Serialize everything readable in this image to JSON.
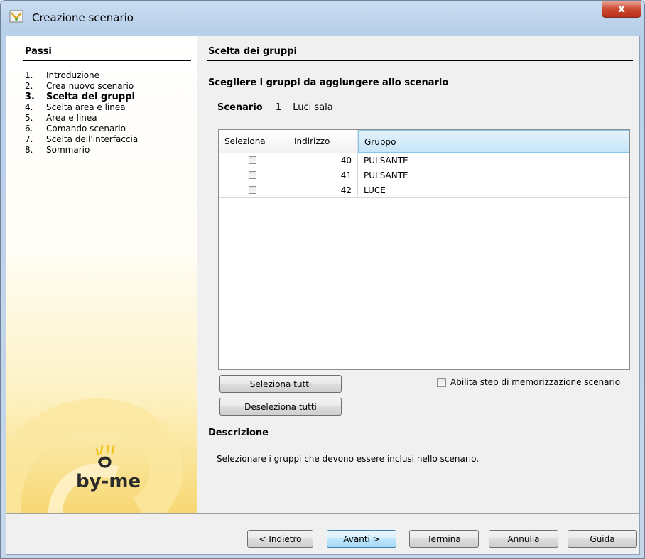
{
  "window": {
    "title": "Creazione scenario",
    "close_label": "x"
  },
  "sidebar": {
    "title": "Passi",
    "steps": [
      {
        "num": "1.",
        "label": "Introduzione"
      },
      {
        "num": "2.",
        "label": "Crea nuovo scenario"
      },
      {
        "num": "3.",
        "label": "Scelta dei gruppi"
      },
      {
        "num": "4.",
        "label": "Scelta area e linea"
      },
      {
        "num": "5.",
        "label": "Area e linea"
      },
      {
        "num": "6.",
        "label": "Comando scenario"
      },
      {
        "num": "7.",
        "label": "Scelta dell'interfaccia"
      },
      {
        "num": "8.",
        "label": "Sommario"
      }
    ],
    "active_step": 3,
    "logo_text": "by-me"
  },
  "main": {
    "title": "Scelta dei gruppi",
    "subtitle": "Scegliere i gruppi da aggiungere allo scenario",
    "scenario": {
      "label": "Scenario",
      "number": "1",
      "name": "Luci sala"
    },
    "table": {
      "headers": [
        "Seleziona",
        "Indirizzo",
        "Gruppo"
      ],
      "rows": [
        {
          "selected": false,
          "address": "40",
          "group": "PULSANTE"
        },
        {
          "selected": false,
          "address": "41",
          "group": "PULSANTE"
        },
        {
          "selected": false,
          "address": "42",
          "group": "LUCE"
        }
      ]
    },
    "select_all_label": "Seleziona tutti",
    "deselect_all_label": "Deseleziona tutti",
    "enable_step_label": "Abilita step di memorizzazione scenario",
    "description_title": "Descrizione",
    "description_text": "Selezionare i gruppi che devono essere inclusi nello scenario."
  },
  "footer": {
    "back_label": "< Indietro",
    "next_label": "Avanti >",
    "finish_label": "Termina",
    "cancel_label": "Annulla",
    "help_label": "Guida"
  },
  "colors": {
    "titlebar": "#c9dcf1",
    "close_button": "#cc4a32",
    "sidebar_gradient_end": "#f7d873",
    "header_highlight": "#c6e5f8"
  }
}
